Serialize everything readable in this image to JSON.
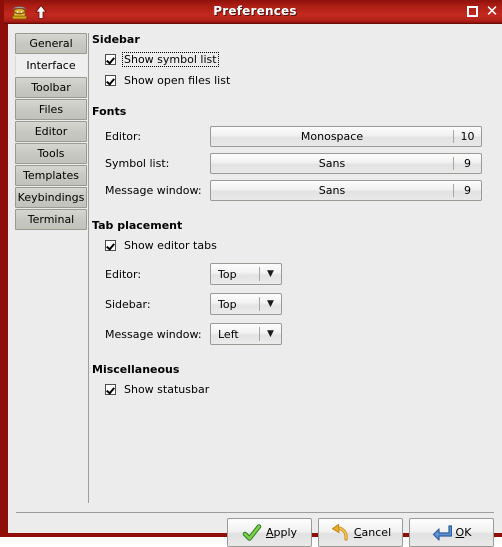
{
  "window": {
    "title": "Preferences",
    "app_icon": "genie-lamp-icon",
    "up_arrow_icon": "up-arrow-icon",
    "maximize_label": "",
    "close_label": "✕",
    "frame_color": "#8f0f08",
    "title_gradient_top": "#8d120c",
    "title_gradient_mid": "#c3291f"
  },
  "tabs": [
    {
      "label": "General",
      "selected": false
    },
    {
      "label": "Interface",
      "selected": true
    },
    {
      "label": "Toolbar",
      "selected": false
    },
    {
      "label": "Files",
      "selected": false
    },
    {
      "label": "Editor",
      "selected": false
    },
    {
      "label": "Tools",
      "selected": false
    },
    {
      "label": "Templates",
      "selected": false
    },
    {
      "label": "Keybindings",
      "selected": false
    },
    {
      "label": "Terminal",
      "selected": false
    }
  ],
  "sections": {
    "sidebar": {
      "title": "Sidebar",
      "checks": [
        {
          "label": "Show symbol list",
          "checked": true,
          "focused": true
        },
        {
          "label": "Show open files list",
          "checked": true,
          "focused": false
        }
      ]
    },
    "fonts": {
      "title": "Fonts",
      "rows": [
        {
          "label": "Editor:",
          "font": "Monospace",
          "size": "10"
        },
        {
          "label": "Symbol list:",
          "font": "Sans",
          "size": "9"
        },
        {
          "label": "Message window:",
          "font": "Sans",
          "size": "9"
        }
      ]
    },
    "tab_placement": {
      "title": "Tab placement",
      "check": {
        "label": "Show editor tabs",
        "checked": true
      },
      "rows": [
        {
          "label": "Editor:",
          "value": "Top"
        },
        {
          "label": "Sidebar:",
          "value": "Top"
        },
        {
          "label": "Message window:",
          "value": "Left"
        }
      ]
    },
    "miscellaneous": {
      "title": "Miscellaneous",
      "checks": [
        {
          "label": "Show statusbar",
          "checked": true,
          "focused": false
        }
      ]
    }
  },
  "actions": [
    {
      "name": "apply",
      "label": "Apply",
      "mnemonic": "A",
      "rest": "pply",
      "icon": "green-check-icon",
      "color": "#4aa02c"
    },
    {
      "name": "cancel",
      "label": "Cancel",
      "mnemonic": "C",
      "rest": "ancel",
      "icon": "orange-undo-arrow-icon",
      "color": "#e8a317"
    },
    {
      "name": "ok",
      "label": "OK",
      "mnemonic": "O",
      "rest": "K",
      "icon": "blue-enter-arrow-icon",
      "color": "#3a72c8"
    }
  ]
}
